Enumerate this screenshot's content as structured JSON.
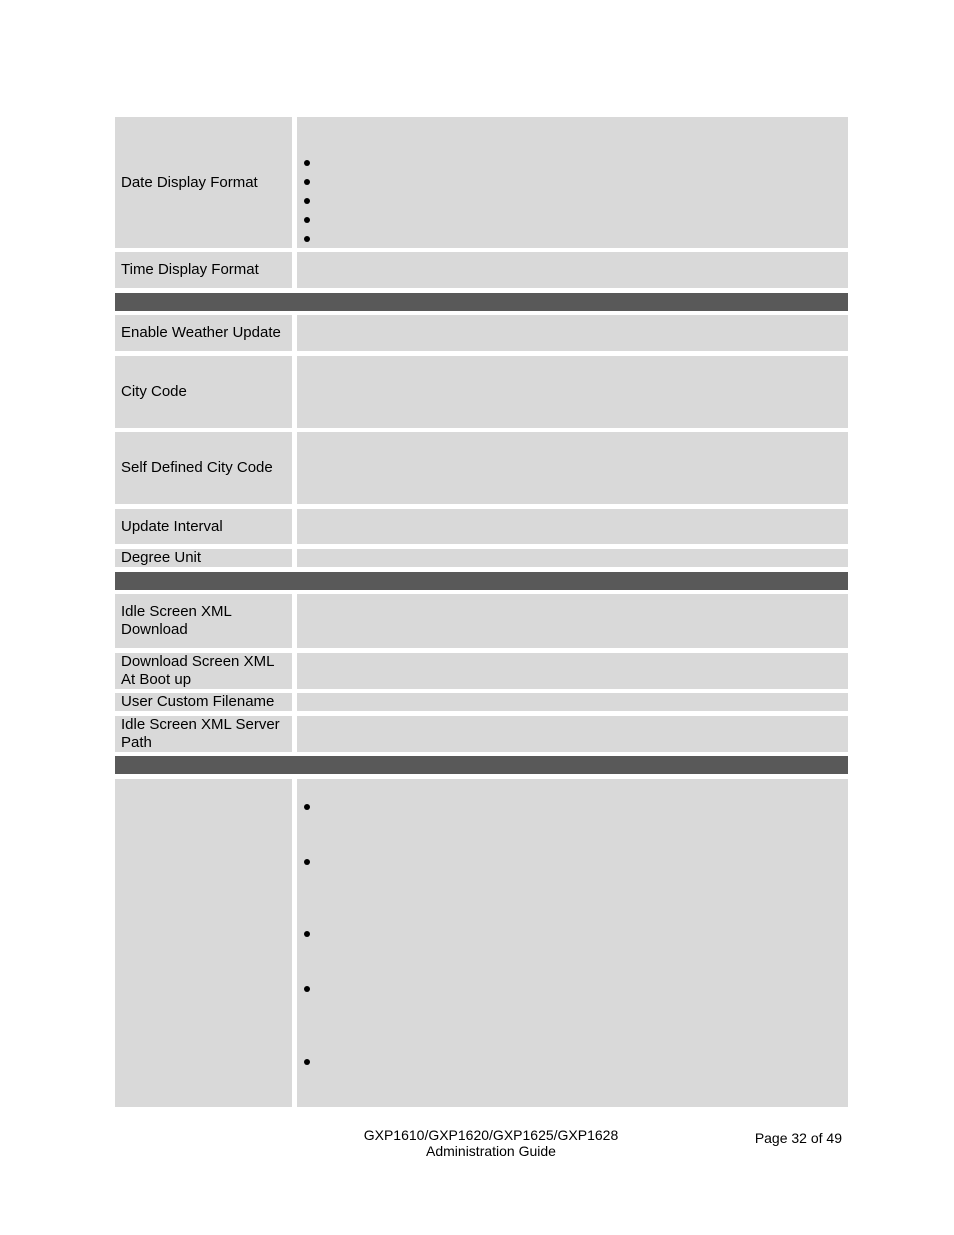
{
  "table": {
    "rows": [
      {
        "label": "Date Display Format",
        "bullets": 5
      },
      {
        "label": "Time Display Format"
      },
      {
        "section": true
      },
      {
        "label": "Enable Weather Update"
      },
      {
        "label": "City Code"
      },
      {
        "label": "Self Defined City Code"
      },
      {
        "label": "Update Interval"
      },
      {
        "label": "Degree Unit"
      },
      {
        "section": true
      },
      {
        "label": "Idle Screen XML Download"
      },
      {
        "label": "Download Screen XML At Boot up"
      },
      {
        "label": "User Custom Filename"
      },
      {
        "label": "Idle Screen XML Server Path"
      },
      {
        "section": true
      },
      {
        "label": "",
        "bullets": 5
      }
    ],
    "colors": {
      "cell": "#d9d9d9",
      "section_bar": "#595959"
    }
  },
  "footer": {
    "product": "GXP1610/GXP1620/GXP1625/GXP1628",
    "doc_title": "Administration Guide",
    "page_label": "Page 32 of 49"
  }
}
